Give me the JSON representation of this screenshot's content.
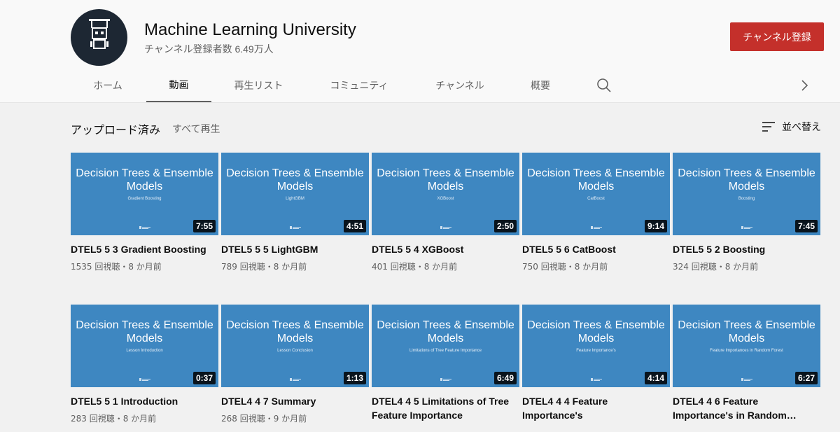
{
  "channel": {
    "name": "Machine Learning University",
    "subscribers": "チャンネル登録者数 6.49万人",
    "subscribe_label": "チャンネル登録",
    "avatar_text": "Machine Learning University"
  },
  "tabs": [
    {
      "label": "ホーム",
      "active": false
    },
    {
      "label": "動画",
      "active": true
    },
    {
      "label": "再生リスト",
      "active": false
    },
    {
      "label": "コミュニティ",
      "active": false
    },
    {
      "label": "チャンネル",
      "active": false
    },
    {
      "label": "概要",
      "active": false
    }
  ],
  "section": {
    "title": "アップロード済み",
    "play_all": "すべて再生",
    "sort_label": "並べ替え"
  },
  "colors": {
    "thumbnail": "#3e87c1",
    "subscribe": "#c4302b"
  },
  "videos": [
    {
      "thumb_title": "Decision Trees & Ensemble Models",
      "thumb_subtitle": "Gradient Boosting",
      "duration": "7:55",
      "title": "DTEL5 5 3 Gradient Boosting",
      "meta": "1535 回視聴・8 か月前"
    },
    {
      "thumb_title": "Decision Trees & Ensemble Models",
      "thumb_subtitle": "LightGBM",
      "duration": "4:51",
      "title": "DTEL5 5 5 LightGBM",
      "meta": "789 回視聴・8 か月前"
    },
    {
      "thumb_title": "Decision Trees & Ensemble Models",
      "thumb_subtitle": "XGBoost",
      "duration": "2:50",
      "title": "DTEL5 5 4 XGBoost",
      "meta": "401 回視聴・8 か月前"
    },
    {
      "thumb_title": "Decision Trees & Ensemble Models",
      "thumb_subtitle": "CatBoost",
      "duration": "9:14",
      "title": "DTEL5 5 6 CatBoost",
      "meta": "750 回視聴・8 か月前"
    },
    {
      "thumb_title": "Decision Trees & Ensemble Models",
      "thumb_subtitle": "Boosting",
      "duration": "7:45",
      "title": "DTEL5 5 2 Boosting",
      "meta": "324 回視聴・8 か月前"
    },
    {
      "thumb_title": "Decision Trees & Ensemble Models",
      "thumb_subtitle": "Lesson Introduction",
      "duration": "0:37",
      "title": "DTEL5 5 1 Introduction",
      "meta": "283 回視聴・8 か月前"
    },
    {
      "thumb_title": "Decision Trees & Ensemble Models",
      "thumb_subtitle": "Lesson Conclusion",
      "duration": "1:13",
      "title": "DTEL4 4 7 Summary",
      "meta": "268 回視聴・9 か月前"
    },
    {
      "thumb_title": "Decision Trees & Ensemble Models",
      "thumb_subtitle": "Limitations of Tree Feature Importance",
      "duration": "6:49",
      "title": "DTEL4 4 5 Limitations of Tree Feature Importance",
      "meta": ""
    },
    {
      "thumb_title": "Decision Trees & Ensemble Models",
      "thumb_subtitle": "Feature Importance's",
      "duration": "4:14",
      "title": "DTEL4 4 4 Feature Importance's",
      "meta": ""
    },
    {
      "thumb_title": "Decision Trees & Ensemble Models",
      "thumb_subtitle": "Feature Importances in Random Forest",
      "duration": "6:27",
      "title": "DTEL4 4 6 Feature Importance's in Random…",
      "meta": ""
    }
  ]
}
